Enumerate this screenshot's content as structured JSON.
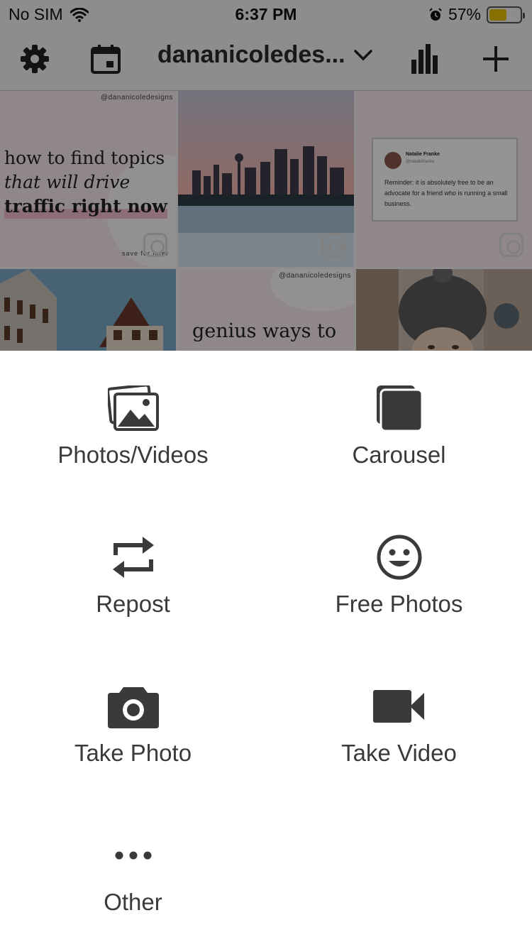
{
  "status_bar": {
    "carrier": "No SIM",
    "time": "6:37 PM",
    "battery_percent": "57%",
    "battery_level": 0.57,
    "icons": [
      "wifi-icon",
      "alarm-icon",
      "battery-icon"
    ]
  },
  "nav": {
    "account_name": "dananicoledes...",
    "icons": [
      "gear-icon",
      "calendar-icon",
      "chevron-down-icon",
      "bar-chart-icon",
      "plus-icon"
    ]
  },
  "grid": {
    "tile1": {
      "watermark": "@dananicoledesigns",
      "line1": "how to find topics",
      "line2": "that will drive",
      "line3": "traffic right now",
      "footer": "save for later"
    },
    "tile3": {
      "name": "Natalie Franke",
      "handle": "@nataliefranke",
      "body": "Reminder: it is absolutely free to be an advocate for a friend who is running a small business."
    },
    "tile5": {
      "watermark": "@dananicoledesigns",
      "text": "genius ways to"
    }
  },
  "sheet": {
    "options": [
      {
        "label": "Photos/Videos",
        "icon": "photos-icon"
      },
      {
        "label": "Carousel",
        "icon": "carousel-icon"
      },
      {
        "label": "Repost",
        "icon": "repost-icon"
      },
      {
        "label": "Free Photos",
        "icon": "smiley-icon"
      },
      {
        "label": "Take Photo",
        "icon": "camera-icon"
      },
      {
        "label": "Take Video",
        "icon": "video-camera-icon"
      },
      {
        "label": "Other",
        "icon": "more-dots-icon"
      }
    ]
  },
  "colors": {
    "icon": "#3a3a3a",
    "label": "#3a3a3a",
    "battery_fill": "#e6c100",
    "overlay": "rgba(0,0,0,0.42)"
  }
}
